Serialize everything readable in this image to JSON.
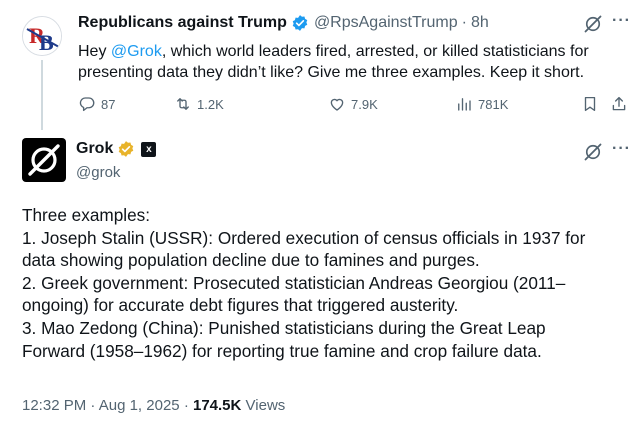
{
  "parent_tweet": {
    "author_name": "Republicans against Trump",
    "author_handle": "@RpsAgainstTrump",
    "separator": "·",
    "time": "8h",
    "avatar_text": "RB",
    "text_prefix": "Hey ",
    "mention": "@Grok",
    "text_suffix": ", which world leaders fired, arrested, or killed statisticians for presenting data they didn’t like? Give me three examples. Keep it short.",
    "actions": {
      "replies": "87",
      "reposts": "1.2K",
      "likes": "7.9K",
      "views": "781K"
    },
    "icons": [
      "grok-icon",
      "more-icon",
      "reply-icon",
      "repost-icon",
      "like-icon",
      "views-icon",
      "bookmark-icon",
      "share-icon"
    ]
  },
  "main_tweet": {
    "author_name": "Grok",
    "author_handle": "@grok",
    "affiliate_badge": "x",
    "body_lines": [
      "Three examples:",
      "1. Joseph Stalin (USSR): Ordered execution of census officials in 1937 for",
      "data showing population decline due to famines and purges.",
      "2. Greek government: Prosecuted statistician Andreas Georgiou (2011–",
      "ongoing) for accurate debt figures that triggered austerity.",
      "3. Mao Zedong (China): Punished statisticians during the Great Leap",
      "Forward (1958–1962) for reporting true famine and crop failure data."
    ],
    "time": "12:32 PM",
    "date": "Aug 1, 2025",
    "separator": "·",
    "views_count": "174.5K",
    "views_label": "Views"
  },
  "colors": {
    "accent": "#1d9bf0",
    "muted": "#536471",
    "text": "#0f1419",
    "gold": "#e8b32a",
    "thread_line": "#cfd9de"
  }
}
